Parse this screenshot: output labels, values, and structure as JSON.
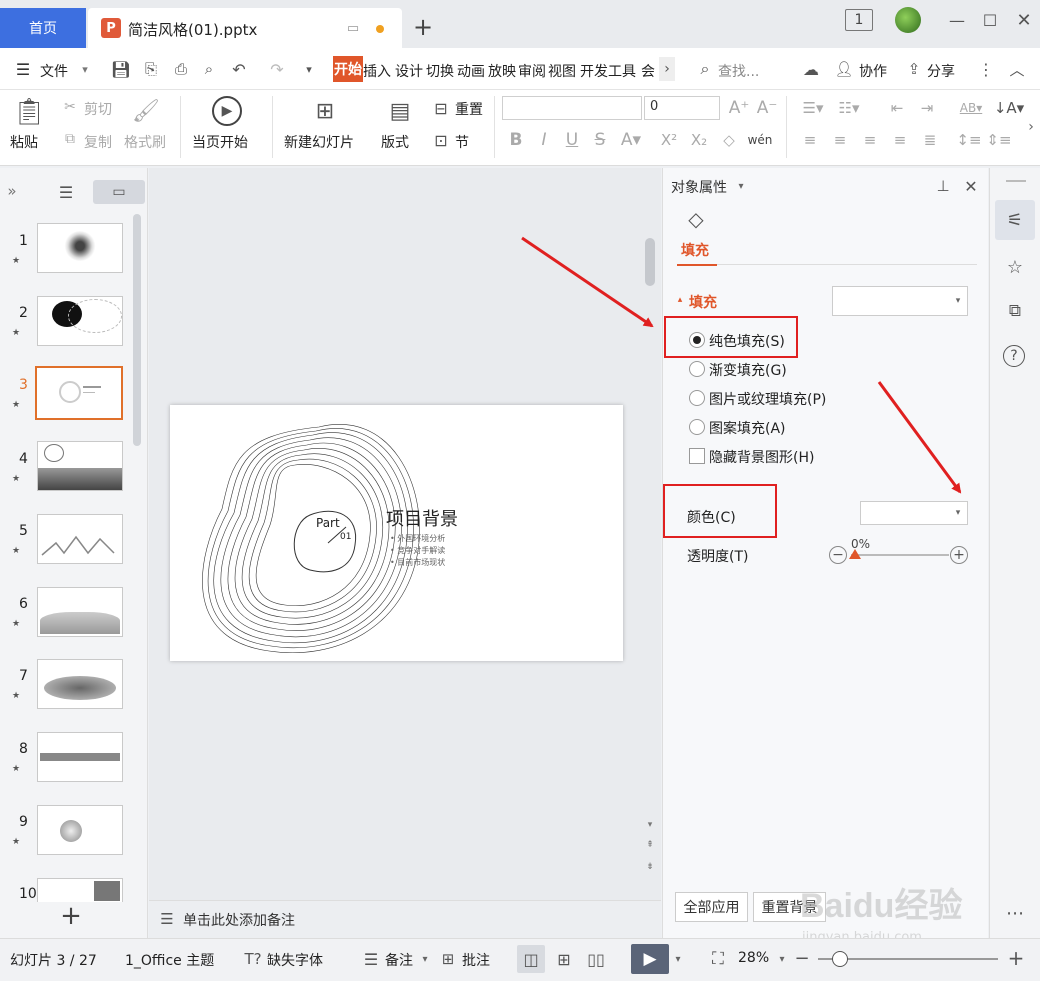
{
  "titlebar": {
    "home_tab": "首页",
    "doc_tab": "简洁风格(01).pptx",
    "new_tab": "+"
  },
  "menubar": {
    "file": "文件",
    "tabs": [
      "开始",
      "插入",
      "设计",
      "切换",
      "动画",
      "放映",
      "审阅",
      "视图",
      "开发工具",
      "会"
    ],
    "search_placeholder": "查找...",
    "collab": "协作",
    "share": "分享"
  },
  "ribbon": {
    "paste": "粘贴",
    "cut": "剪切",
    "copy": "复制",
    "format_painter": "格式刷",
    "start_from_current": "当页开始",
    "new_slide": "新建幻灯片",
    "layout": "版式",
    "reset": "重置",
    "section": "节",
    "font_size": "0"
  },
  "slides": {
    "numbers": [
      "1",
      "2",
      "3",
      "4",
      "5",
      "6",
      "7",
      "8",
      "9",
      "10"
    ],
    "selected": "3",
    "add": "+"
  },
  "slide": {
    "part": "Part",
    "part_no": "01",
    "title": "项目背景",
    "bullets": [
      "外国环境分析",
      "竞争对手解读",
      "目前市场现状"
    ]
  },
  "notes": {
    "placeholder": "单击此处添加备注"
  },
  "props": {
    "header": "对象属性",
    "tab_fill": "填充",
    "section_fill": "填充",
    "options": [
      "纯色填充(S)",
      "渐变填充(G)",
      "图片或纹理填充(P)",
      "图案填充(A)"
    ],
    "hide_bg": "隐藏背景图形(H)",
    "color_label": "颜色(C)",
    "transparency_label": "透明度(T)",
    "transparency_value": "0%",
    "apply_all": "全部应用",
    "reset_bg": "重置背景"
  },
  "status": {
    "slide_counter": "幻灯片 3 / 27",
    "theme": "1_Office 主题",
    "missing_font": "缺失字体",
    "notes": "备注",
    "comments": "批注",
    "zoom": "28%"
  },
  "watermark": {
    "text": "Baidu经验",
    "url": "jingyan.baidu.com"
  },
  "colors": {
    "accent": "#e0562a",
    "home_tab": "#3d6fe0",
    "red_annotation": "#e02020",
    "selected_thumb": "#e0702a"
  }
}
